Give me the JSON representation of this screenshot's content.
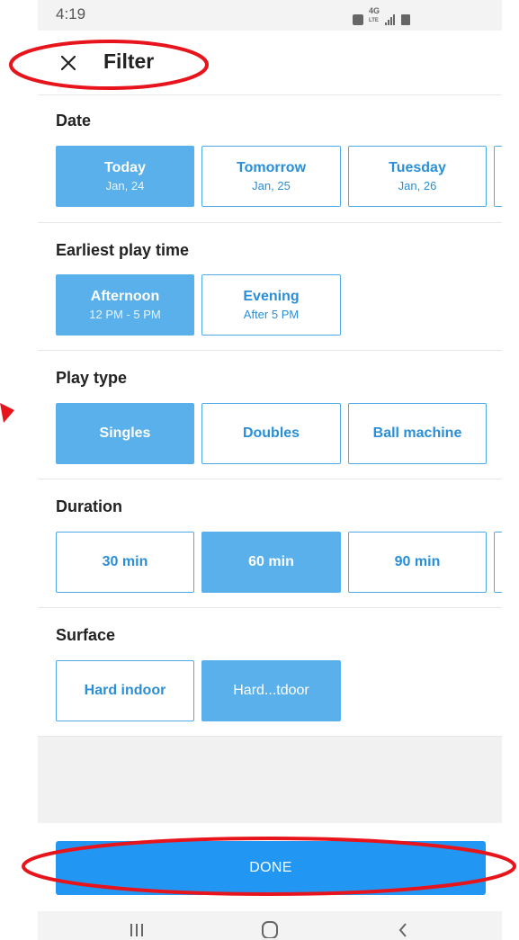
{
  "status_bar": {
    "time": "4:19",
    "network": "4G",
    "network_sub": "LTE"
  },
  "header": {
    "title": "Filter",
    "close_icon": "close-icon"
  },
  "sections": {
    "date": {
      "title": "Date",
      "options": [
        {
          "label": "Today",
          "sub": "Jan, 24",
          "selected": true
        },
        {
          "label": "Tomorrow",
          "sub": "Jan, 25",
          "selected": false
        },
        {
          "label": "Tuesday",
          "sub": "Jan, 26",
          "selected": false
        }
      ]
    },
    "earliest_play_time": {
      "title": "Earliest play time",
      "options": [
        {
          "label": "Afternoon",
          "sub": "12 PM - 5 PM",
          "selected": true
        },
        {
          "label": "Evening",
          "sub": "After 5 PM",
          "selected": false
        }
      ]
    },
    "play_type": {
      "title": "Play type",
      "options": [
        {
          "label": "Singles",
          "selected": true
        },
        {
          "label": "Doubles",
          "selected": false
        },
        {
          "label": "Ball machine",
          "selected": false
        }
      ]
    },
    "duration": {
      "title": "Duration",
      "options": [
        {
          "label": "30 min",
          "selected": false
        },
        {
          "label": "60 min",
          "selected": true
        },
        {
          "label": "90 min",
          "selected": false
        }
      ]
    },
    "surface": {
      "title": "Surface",
      "options": [
        {
          "label": "Hard indoor",
          "selected": false
        },
        {
          "label": "Hard...tdoor",
          "selected": true
        }
      ]
    }
  },
  "footer": {
    "done_label": "DONE"
  },
  "colors": {
    "accent": "#2196f3",
    "chip_selected": "#5ab0ea",
    "chip_border": "#4fa9e6",
    "chip_text": "#2a8fd6",
    "annotation": "#e8141c"
  }
}
